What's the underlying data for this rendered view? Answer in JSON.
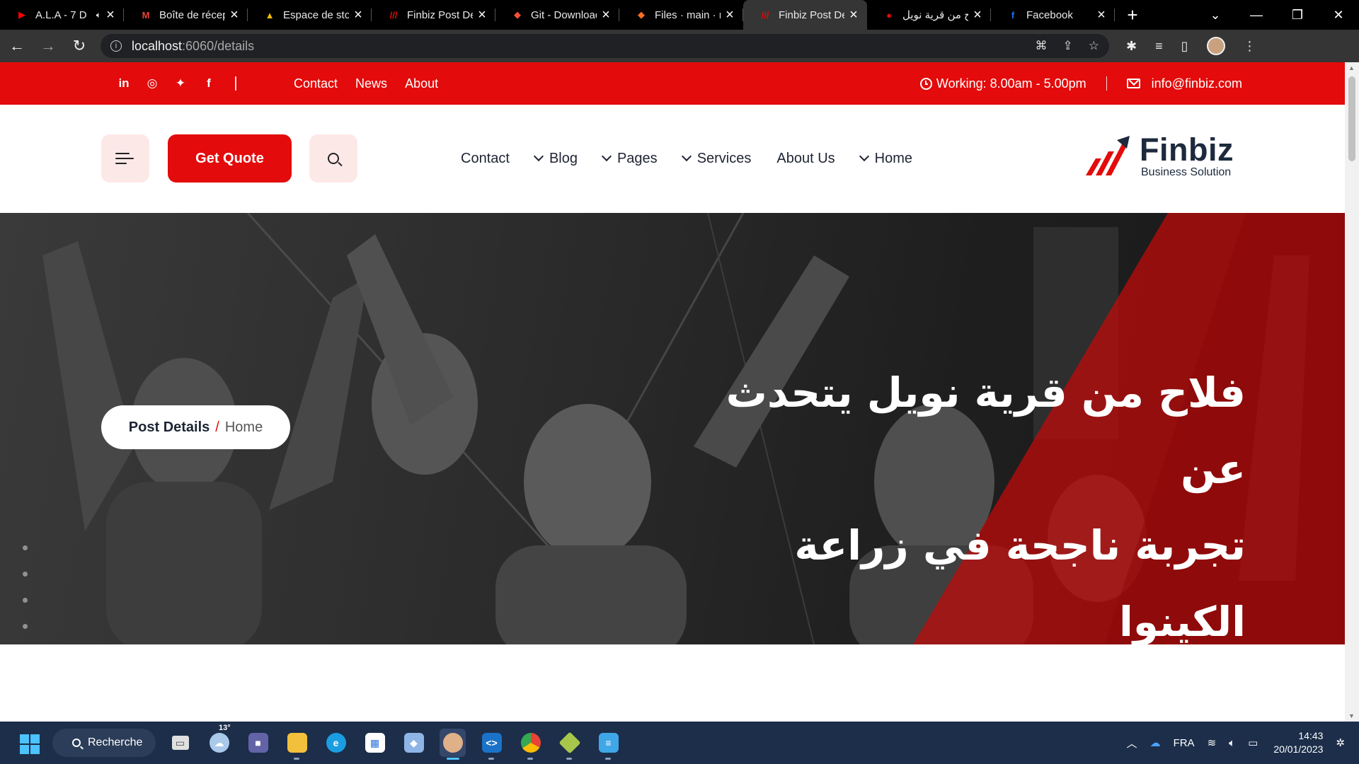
{
  "browser": {
    "tabs": [
      {
        "title": "A.L.A - 7 D",
        "favicon": "youtube-icon",
        "color": "#ff0000",
        "glyph": "▶",
        "audio": true,
        "active": false
      },
      {
        "title": "Boîte de réception",
        "favicon": "gmail-icon",
        "color": "#ea4335",
        "glyph": "M",
        "active": false
      },
      {
        "title": "Espace de stockage",
        "favicon": "google-drive-icon",
        "color": "#fbbc04",
        "glyph": "▲",
        "active": false
      },
      {
        "title": "Finbiz Post Details",
        "favicon": "finbiz-icon",
        "color": "#e30b0b",
        "glyph": "///",
        "active": false
      },
      {
        "title": "Git - Downloads",
        "favicon": "git-icon",
        "color": "#f05133",
        "glyph": "◆",
        "active": false
      },
      {
        "title": "Files · main · no",
        "favicon": "gitlab-icon",
        "color": "#fc6d26",
        "glyph": "◆",
        "active": false
      },
      {
        "title": "Finbiz Post Details",
        "favicon": "finbiz-icon",
        "color": "#e30b0b",
        "glyph": "///",
        "active": true
      },
      {
        "title": "فلاح من قرية نويل",
        "favicon": "red-logo-icon",
        "color": "#e30b0b",
        "glyph": "●",
        "active": false
      },
      {
        "title": "Facebook",
        "favicon": "facebook-icon",
        "color": "#1877f2",
        "glyph": "f",
        "active": false
      }
    ],
    "url_host": "localhost",
    "url_path": ":6060/details"
  },
  "topbar": {
    "links": [
      "Contact",
      "News",
      "About"
    ],
    "working": "Working: 8.00am - 5.00pm",
    "email": "info@finbiz.com"
  },
  "header": {
    "quote_button": "Get Quote",
    "nav": [
      {
        "label": "Contact",
        "dropdown": false
      },
      {
        "label": "Blog",
        "dropdown": true
      },
      {
        "label": "Pages",
        "dropdown": true
      },
      {
        "label": "Services",
        "dropdown": true
      },
      {
        "label": "About Us",
        "dropdown": false
      },
      {
        "label": "Home",
        "dropdown": true
      }
    ],
    "logo_name": "Finbiz",
    "logo_tagline": "Business Solution",
    "accent": "#e30b0b"
  },
  "hero": {
    "breadcrumb_current": "Post Details",
    "breadcrumb_separator": "/",
    "breadcrumb_home": "Home",
    "title_line1": "فلاح من قرية نويل يتحدث عن",
    "title_line2": "تجربة ناجحة في زراعة الكينوا"
  },
  "taskbar": {
    "search_label": "Recherche",
    "weather_temp": "13°",
    "language": "FRA",
    "time": "14:43",
    "date": "20/01/2023"
  }
}
